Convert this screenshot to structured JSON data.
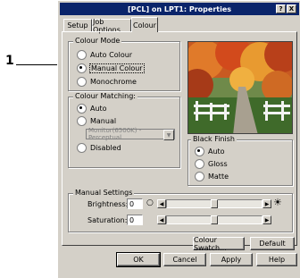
{
  "callout": {
    "number": "1"
  },
  "window": {
    "title": "[PCL] on LPT1: Properties",
    "help_btn": "?",
    "close_btn": "X"
  },
  "tabs": [
    {
      "label": "Setup"
    },
    {
      "label": "Job Options"
    },
    {
      "label": "Colour"
    }
  ],
  "colour_mode": {
    "title": "Colour Mode",
    "options": [
      {
        "label": "Auto Colour",
        "selected": false
      },
      {
        "label": "Manual Colour",
        "selected": true
      },
      {
        "label": "Monochrome",
        "selected": false
      }
    ]
  },
  "colour_matching": {
    "title": "Colour Matching:",
    "options": [
      {
        "label": "Auto",
        "selected": true
      },
      {
        "label": "Manual",
        "selected": false
      },
      {
        "label": "Disabled",
        "selected": false
      }
    ],
    "profile_select": "Monitor(6500K) - Perceptual"
  },
  "black_finish": {
    "title": "Black Finish",
    "options": [
      {
        "label": "Auto",
        "selected": true
      },
      {
        "label": "Gloss",
        "selected": false
      },
      {
        "label": "Matte",
        "selected": false
      }
    ]
  },
  "manual_settings": {
    "title": "Manual Settings",
    "brightness": {
      "label": "Brightness:",
      "value": "0",
      "level": 0.5
    },
    "saturation": {
      "label": "Saturation:",
      "value": "0",
      "level": 0.5
    }
  },
  "buttons": {
    "colour_swatch": "Colour Swatch...",
    "default": "Default",
    "ok": "OK",
    "cancel": "Cancel",
    "apply": "Apply",
    "help": "Help"
  },
  "icons": {
    "sun": "sun-icon",
    "dark": "dark-icon",
    "arrow_left": "arrow-left-icon",
    "arrow_right": "arrow-right-icon"
  },
  "colors": {
    "titlebar": "#0a246a",
    "face": "#d4d0c8"
  }
}
